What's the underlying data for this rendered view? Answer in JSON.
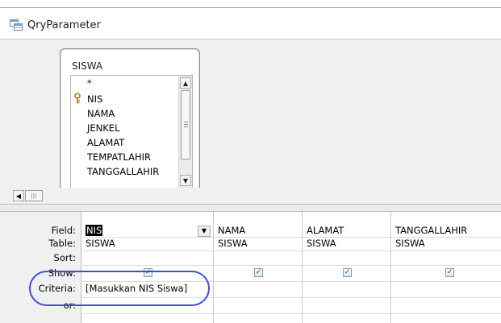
{
  "window": {
    "title": "QryParameter"
  },
  "field_list": {
    "table_name": "SISWA",
    "fields": [
      "*",
      "NIS",
      "NAMA",
      "JENKEL",
      "ALAMAT",
      "TEMPATLAHIR",
      "TANGGALLAHIR"
    ],
    "primary_key_field": "NIS"
  },
  "grid": {
    "row_labels": {
      "field": "Field:",
      "table": "Table:",
      "sort": "Sort:",
      "show": "Show:",
      "criteria": "Criteria:",
      "or": "or:"
    },
    "columns": [
      {
        "field": "NIS",
        "table": "SISWA",
        "show": true,
        "criteria": "[Masukkan NIS Siswa]"
      },
      {
        "field": "NAMA",
        "table": "SISWA",
        "show": true,
        "criteria": ""
      },
      {
        "field": "ALAMAT",
        "table": "SISWA",
        "show": true,
        "criteria": ""
      },
      {
        "field": "TANGGALLAHIR",
        "table": "SISWA",
        "show": true,
        "criteria": ""
      }
    ]
  },
  "colors": {
    "annotation": "#3d4fd8",
    "pane_background": "#f0f0f0"
  },
  "icons": {
    "tab": "query-icon",
    "key": "primary-key-icon"
  }
}
